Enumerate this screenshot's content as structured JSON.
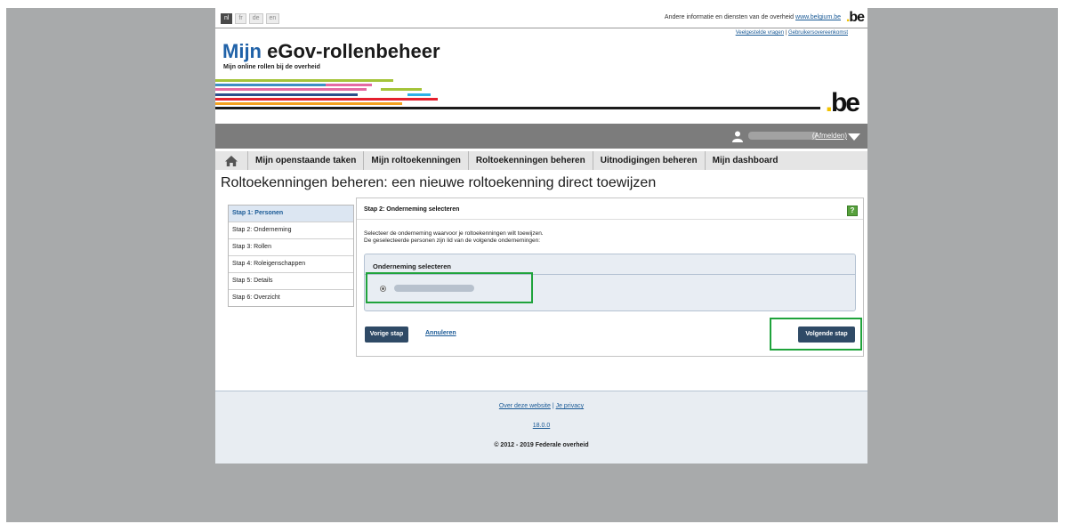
{
  "languages": [
    "nl",
    "fr",
    "de",
    "en"
  ],
  "header": {
    "other_info_text": "Andere informatie en diensten van de overheid",
    "other_info_link": "www.belgium.be",
    "be_logo": "be",
    "utility_faq": "Veelgestelde vragen",
    "utility_separator": "|",
    "utility_terms": "Gebruikersovereenkomst",
    "title_prefix": "Mijn",
    "title_rest": " eGov-rollenbeheer",
    "subtitle": "Mijn online rollen bij de overheid",
    "brand_logo": "be"
  },
  "userbar": {
    "logout_label": "(Afmelden)"
  },
  "nav": {
    "home_icon": "home-icon",
    "items": [
      "Mijn openstaande taken",
      "Mijn roltoekenningen",
      "Roltoekenningen beheren",
      "Uitnodigingen beheren",
      "Mijn dashboard"
    ]
  },
  "page_title": "Roltoekenningen beheren: een nieuwe roltoekenning direct toewijzen",
  "steps": [
    {
      "label": "Stap 1: Personen",
      "active": true
    },
    {
      "label": "Stap 2: Onderneming",
      "active": false
    },
    {
      "label": "Stap 3: Rollen",
      "active": false
    },
    {
      "label": "Stap 4: Roleigenschappen",
      "active": false
    },
    {
      "label": "Stap 5: Details",
      "active": false
    },
    {
      "label": "Stap 6: Overzicht",
      "active": false
    }
  ],
  "panel": {
    "title": "Stap 2: Onderneming selecteren",
    "help_label": "?",
    "text1": "Selecteer de onderneming waarvoor je roltoekenningen wilt toewijzen.",
    "text2": "De geselecteerde personen zijn lid van de volgende ondernemingen:",
    "select_title": "Onderneming selecteren",
    "prev_button": "Vorige stap",
    "cancel_link": "Annuleren",
    "next_button": "Volgende stap"
  },
  "footer": {
    "about_link": "Over deze website",
    "separator": "|",
    "privacy_link": "Je privacy",
    "version": "18.0.0",
    "copyright": "© 2012 - 2019 Federale overheid"
  },
  "colors": {
    "brand_blue": "#2062a8",
    "button_dark": "#2f4a66",
    "highlight_green": "#1fa33b",
    "be_yellow": "#f2c200"
  }
}
